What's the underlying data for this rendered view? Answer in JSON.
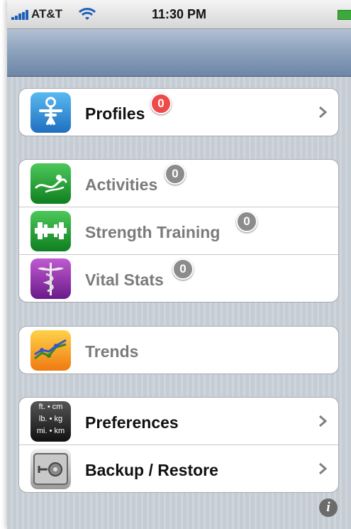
{
  "status_bar": {
    "carrier": "AT&T",
    "time": "11:30 PM"
  },
  "groups": [
    {
      "rows": [
        {
          "label": "Profiles",
          "badge": "0",
          "badge_color": "#ef4a4a",
          "icon": "profile-person-icon",
          "chevron": true,
          "enabled": true
        }
      ]
    },
    {
      "rows": [
        {
          "label": "Activities",
          "badge": "0",
          "icon": "activities-wave-icon",
          "chevron": false,
          "enabled": false
        },
        {
          "label": "Strength Training",
          "badge": "0",
          "icon": "dumbbell-icon",
          "chevron": false,
          "enabled": false
        },
        {
          "label": "Vital Stats",
          "badge": "0",
          "icon": "caduceus-icon",
          "chevron": false,
          "enabled": false
        }
      ]
    },
    {
      "rows": [
        {
          "label": "Trends",
          "icon": "trends-chart-icon",
          "chevron": false,
          "enabled": false
        }
      ]
    },
    {
      "rows": [
        {
          "label": "Preferences",
          "icon": "units-icon",
          "chevron": true,
          "enabled": true,
          "units": [
            "ft. • cm",
            "lb. • kg",
            "mi. • km"
          ]
        },
        {
          "label": "Backup / Restore",
          "icon": "safe-icon",
          "chevron": true,
          "enabled": true
        }
      ]
    }
  ],
  "info_button": "i",
  "colors": {
    "nav_bar": "#8aa0bb",
    "badge_red": "#ef4a4a",
    "badge_gray": "#8c8c8c",
    "text_active": "#111111",
    "text_disabled": "#7b7b7b"
  }
}
